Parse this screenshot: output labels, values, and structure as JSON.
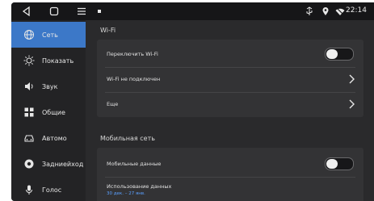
{
  "statusbar": {
    "time": "22:14",
    "nav_icons": [
      "back-icon",
      "home-icon",
      "menu-icon"
    ],
    "indicators": [
      "usb-icon",
      "location-icon",
      "wifi-off-icon"
    ]
  },
  "sidebar": {
    "items": [
      {
        "label": "Сеть",
        "icon": "globe-icon",
        "active": true
      },
      {
        "label": "Показать",
        "icon": "brightness-icon"
      },
      {
        "label": "Звук",
        "icon": "speaker-icon"
      },
      {
        "label": "Общие",
        "icon": "apps-icon"
      },
      {
        "label": "Автомо",
        "icon": "car-icon"
      },
      {
        "label": "Задниейход",
        "icon": "camera-icon"
      },
      {
        "label": "Голос",
        "icon": "microphone-icon"
      }
    ]
  },
  "content": {
    "wifi_section": {
      "title": "Wi-Fi",
      "rows": {
        "toggle_label": "Переключить Wi-Fi",
        "toggle_on": false,
        "status_label": "Wi-Fi не подключен",
        "more_label": "Еще"
      }
    },
    "mobile_section": {
      "title": "Мобильная сеть",
      "rows": {
        "data_label": "Мобильные данные",
        "data_on": false,
        "usage_label": "Использование данных",
        "usage_sub": "30 дек. – 27 янв."
      }
    }
  },
  "colors": {
    "accent": "#3c78c8",
    "background": "#2a2a2c",
    "sidebar": "#232325",
    "link": "#5aa0ff"
  }
}
